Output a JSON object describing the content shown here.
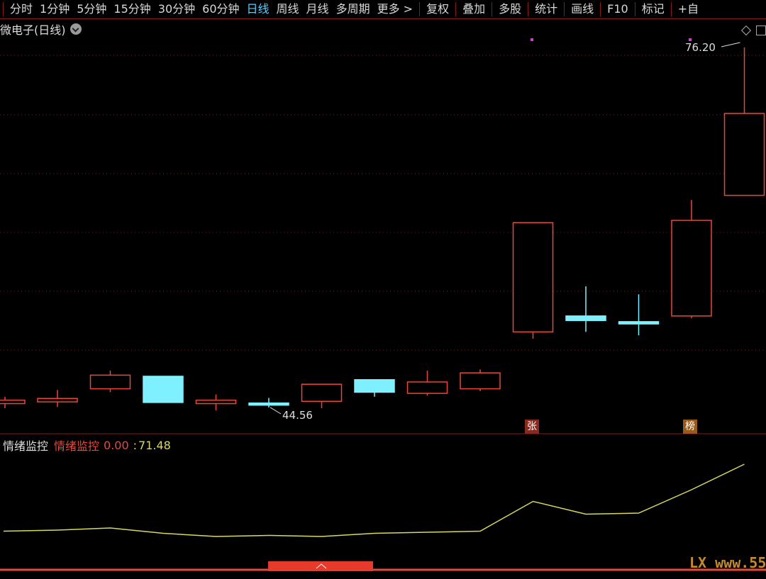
{
  "toolbar": {
    "periods": [
      "分时",
      "1分钟",
      "5分钟",
      "15分钟",
      "30分钟",
      "60分钟",
      "日线",
      "周线",
      "月线",
      "多周期",
      "更多 >"
    ],
    "active_period": "日线",
    "tools": [
      "复权",
      "叠加",
      "多股",
      "统计",
      "画线",
      "F10",
      "标记",
      "+自"
    ]
  },
  "header": {
    "title": "微电子(日线)"
  },
  "price_labels": {
    "high": "76.20",
    "low": "44.56"
  },
  "badges": {
    "zhang": "张",
    "bang": "榜"
  },
  "indicator": {
    "name": "情绪监控",
    "legend_name": "情绪监控",
    "value1": "0.00",
    "value2": "71.48"
  },
  "watermark": "LX www.55",
  "colors": {
    "up": "#e8473c",
    "down": "#7ff0ff",
    "line": "#d8d860",
    "grid": "#8a1a1a",
    "active_tab": "#55d0ff"
  },
  "chart_data": {
    "type": "candlestick",
    "candles": [
      {
        "open": 44.9,
        "close": 45.2,
        "high": 45.5,
        "low": 44.5
      },
      {
        "open": 45.05,
        "close": 45.35,
        "high": 46.1,
        "low": 44.6
      },
      {
        "open": 46.2,
        "close": 47.4,
        "high": 47.8,
        "low": 45.9
      },
      {
        "open": 47.3,
        "close": 45.0,
        "high": 47.3,
        "low": 45.0
      },
      {
        "open": 44.9,
        "close": 45.2,
        "high": 45.7,
        "low": 44.3
      },
      {
        "open": 44.95,
        "close": 44.9,
        "high": 45.4,
        "low": 44.56
      },
      {
        "open": 45.1,
        "close": 46.6,
        "high": 46.6,
        "low": 44.5
      },
      {
        "open": 47.0,
        "close": 45.9,
        "high": 47.0,
        "low": 45.5
      },
      {
        "open": 45.8,
        "close": 46.8,
        "high": 47.8,
        "low": 45.6
      },
      {
        "open": 46.2,
        "close": 47.6,
        "high": 47.9,
        "low": 46.0
      },
      {
        "open": 51.2,
        "close": 60.8,
        "high": 60.8,
        "low": 50.6
      },
      {
        "open": 52.6,
        "close": 52.2,
        "high": 55.2,
        "low": 51.2
      },
      {
        "open": 52.1,
        "close": 51.9,
        "high": 54.5,
        "low": 50.9
      },
      {
        "open": 52.6,
        "close": 61.0,
        "high": 62.8,
        "low": 52.4
      },
      {
        "open": 63.2,
        "close": 70.4,
        "high": 76.2,
        "low": 63.2
      }
    ],
    "indicator_line": [
      0.27,
      0.28,
      0.3,
      0.25,
      0.22,
      0.23,
      0.22,
      0.25,
      0.26,
      0.27,
      0.55,
      0.43,
      0.44,
      0.66,
      0.9
    ],
    "price_range": [
      43.0,
      78.0
    ]
  }
}
